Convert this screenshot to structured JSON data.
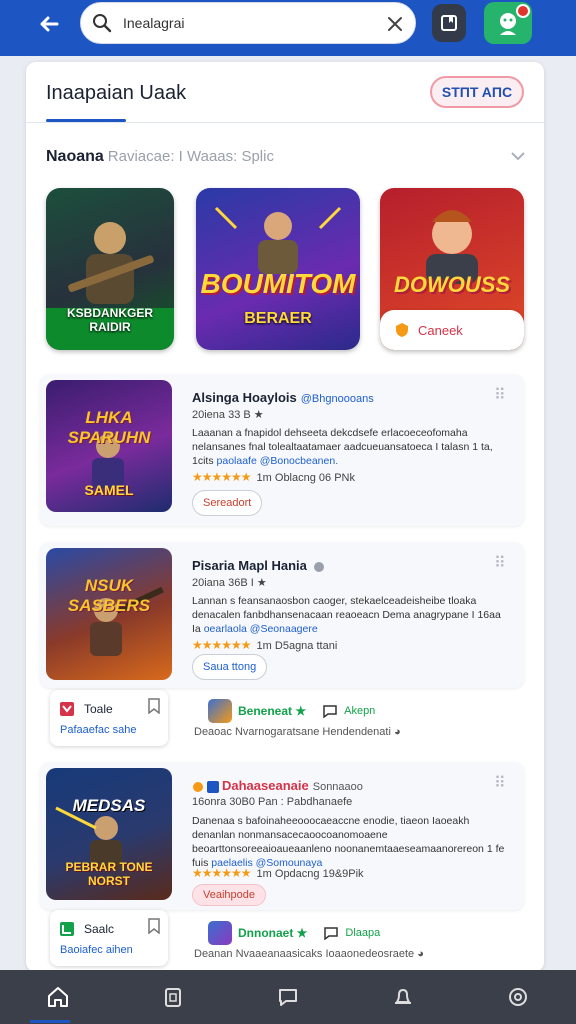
{
  "search": {
    "query": "Inealagrai"
  },
  "tabs": {
    "active": "Inaapaian  Uaak",
    "start_button": "STΠT AΠC"
  },
  "section": {
    "title": "Naoana",
    "subtitle": "Raviacae: I Waaas: Splic"
  },
  "featured": [
    {
      "caption": "KSBDANKGER\nRAIDIR",
      "colors": [
        "#1c4f3c",
        "#0f5c24"
      ]
    },
    {
      "caption": "BOUMITOM",
      "sub": "BERAER",
      "colors": [
        "#2a3aa6",
        "#4b2aa8"
      ]
    },
    {
      "caption": "DOWOUSS",
      "pill": "Caneek",
      "colors": [
        "#b61f2c",
        "#e04a28"
      ]
    }
  ],
  "entries": [
    {
      "thumb_title": "LHKA SPARUHN",
      "thumb_foot": "SAMEL",
      "title": "Alsinga Hoaylois",
      "tag": "@Bhgnoooans",
      "meta": "20iena 33 B ★",
      "desc": "Laaanan a fnapidol dehseeta dekcdsefe erlacoeceofomaha nelansanes fnal tolealtaatamaer aadcueuansatoeca I talasn 1 ta, 1cits",
      "desc_link": "paolaafe @Bonocbeanen.",
      "rating": "1m  Oblacng 06 PNk",
      "button": "Sereadort"
    },
    {
      "thumb_title": "NSUK SASBERS",
      "thumb_foot": "",
      "title": "Pisaria Mapl Hania",
      "tag": "",
      "meta": "20iana 36B I ★",
      "desc": "Lannan s feansanaosbon caoger, stekaelceadeisheibe tloaka denacalen fanbdhansenacaan reaoeacn Dema anagrypane I 16aa Ia",
      "desc_link": "oearlaola @Seonaagere",
      "rating": "1m  D5agna ttani",
      "button": "Saua ttong"
    },
    {
      "thumb_title": "MEDSAS",
      "thumb_foot": "PEBRAR TONE NORST",
      "title": "Dahaaseanaie",
      "tag": "Sonnaaoo",
      "meta": "16onra 30B0  Pan : Pabdhanaefe",
      "desc": "Danenaa s bafoinaheeooocaeaccne enodie, tiaeon Iaoeakh denanlan nonmansacecaoocoanomoaene beoarttonsoreeaioaueaanleno noonanemtaaeseamaanorereon 1 fe fuis",
      "desc_link": "paelaelis @Somounaya",
      "rating": "1m  Opdacng 19&9Pik",
      "button": "Veaihpode"
    }
  ],
  "subcards": [
    {
      "label": "Toale",
      "sub": "Pafaaefac sahe"
    },
    {
      "label": "Saalc",
      "sub": "Baoiafec aihen"
    }
  ],
  "mini_rows": [
    {
      "name": "Beneneat ★",
      "extra": "Akepn",
      "caption": "Deaoac Nvarnogaratsane Hendendenati ◕"
    },
    {
      "name": "Dnnonaet ★",
      "extra": "Dlaapa",
      "caption": "Deanan Nvaaeanaasicaks Ioaaonedeosraete ◕"
    }
  ],
  "colors": {
    "brand": "#1d56c2",
    "accent_green": "#26b36c",
    "star": "#f59a16"
  }
}
